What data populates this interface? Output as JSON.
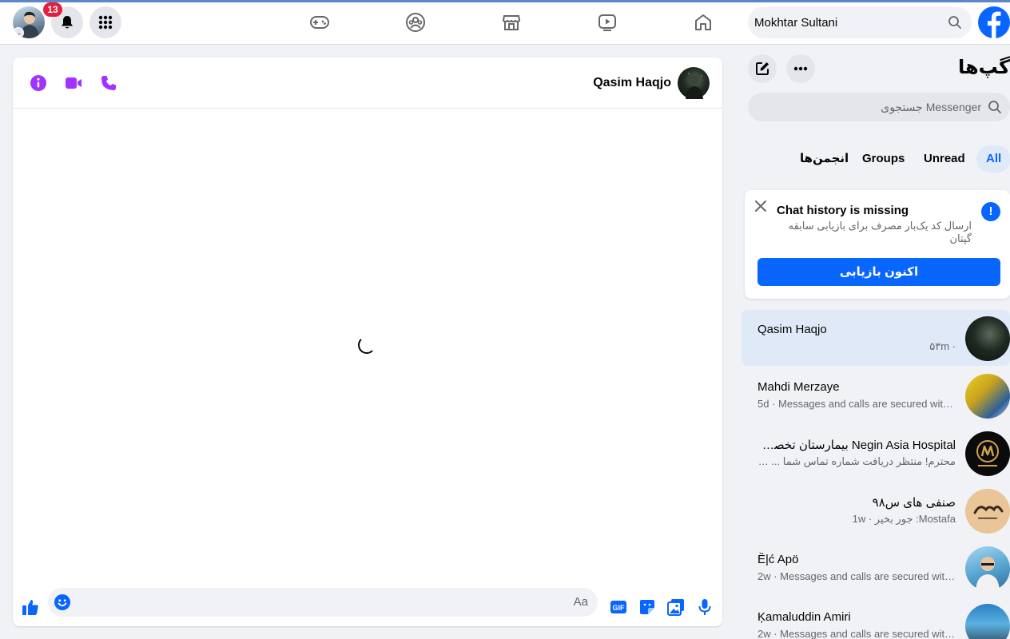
{
  "topbar": {
    "notification_count": "13",
    "search_value": "Mokhtar Sultani",
    "nav_icons": [
      "gaming-icon",
      "groups-icon",
      "marketplace-icon",
      "video-icon",
      "home-icon"
    ]
  },
  "chat": {
    "contact_name": "Qasim Haqjo",
    "composer_placeholder": "Aa",
    "header_icons": [
      "info-icon",
      "video-call-icon",
      "phone-icon"
    ],
    "composer_icons": [
      "like-icon",
      "emoji-icon",
      "gif-icon",
      "sticker-icon",
      "image-icon",
      "microphone-icon"
    ]
  },
  "sidebar": {
    "title": "گپ‌ها",
    "search_placeholder": "جستجوی Messenger",
    "filters": [
      "All",
      "Unread",
      "Groups",
      "انجمن‌ها"
    ],
    "active_filter": "All",
    "notice": {
      "title": "Chat history is missing",
      "description": "ارسال کد یک‌بار مصرف برای بازیابی سابقه گپتان",
      "button": "اکنون بازیابی"
    },
    "conversations": [
      {
        "name": "Qasim Haqjo",
        "meta": "۵۳m ·",
        "selected": true
      },
      {
        "name": "Mahdi Merzaye",
        "meta": "5d · Messages and calls are secured with e..."
      },
      {
        "name": "Negin Asia Hospital بیمارستان تخصصی و معالجوی نگین آسیا",
        "meta": "محترم! منتظر دریافت شماره تماس شما ... · 1w"
      },
      {
        "name": "صنفی های س۹۸",
        "meta": "Mostafa: جور بخیر · 1w"
      },
      {
        "name": "Ȅ|ć Apö",
        "meta": "2w · Messages and calls are secured with ..."
      },
      {
        "name": "Ķamaluddin Amiri",
        "meta": "2w · Messages and calls are secured with ..."
      }
    ]
  },
  "colors": {
    "brand": "#0866ff",
    "messenger_purple": "#a033ff",
    "badge_red": "#e41e3f"
  }
}
